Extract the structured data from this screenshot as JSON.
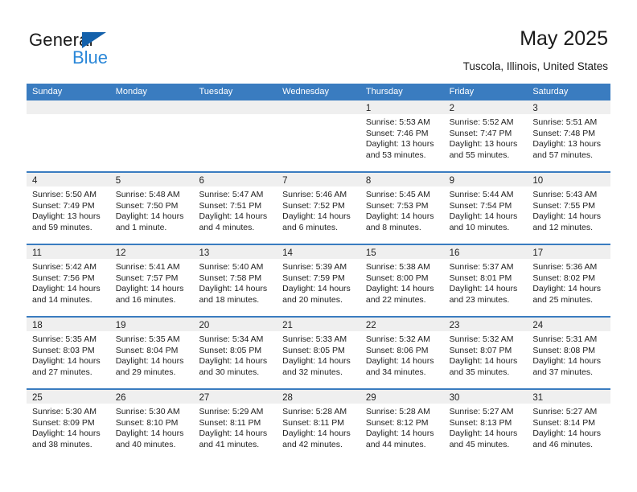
{
  "brand": {
    "name_primary": "General",
    "name_secondary": "Blue",
    "triangle_color": "#1461ab",
    "secondary_color": "#2a87d8"
  },
  "header": {
    "title": "May 2025",
    "subtitle": "Tuscola, Illinois, United States"
  },
  "theme": {
    "header_row_bg": "#3a7cc0",
    "header_row_text": "#ffffff",
    "daynum_band_bg": "#efefef",
    "cell_bg": "#ffffff",
    "text_color": "#222222"
  },
  "calendar": {
    "weekdays": [
      "Sunday",
      "Monday",
      "Tuesday",
      "Wednesday",
      "Thursday",
      "Friday",
      "Saturday"
    ],
    "weeks": [
      [
        {
          "day": "",
          "lines": []
        },
        {
          "day": "",
          "lines": []
        },
        {
          "day": "",
          "lines": []
        },
        {
          "day": "",
          "lines": []
        },
        {
          "day": "1",
          "lines": [
            "Sunrise: 5:53 AM",
            "Sunset: 7:46 PM",
            "Daylight: 13 hours",
            "and 53 minutes."
          ]
        },
        {
          "day": "2",
          "lines": [
            "Sunrise: 5:52 AM",
            "Sunset: 7:47 PM",
            "Daylight: 13 hours",
            "and 55 minutes."
          ]
        },
        {
          "day": "3",
          "lines": [
            "Sunrise: 5:51 AM",
            "Sunset: 7:48 PM",
            "Daylight: 13 hours",
            "and 57 minutes."
          ]
        }
      ],
      [
        {
          "day": "4",
          "lines": [
            "Sunrise: 5:50 AM",
            "Sunset: 7:49 PM",
            "Daylight: 13 hours",
            "and 59 minutes."
          ]
        },
        {
          "day": "5",
          "lines": [
            "Sunrise: 5:48 AM",
            "Sunset: 7:50 PM",
            "Daylight: 14 hours",
            "and 1 minute."
          ]
        },
        {
          "day": "6",
          "lines": [
            "Sunrise: 5:47 AM",
            "Sunset: 7:51 PM",
            "Daylight: 14 hours",
            "and 4 minutes."
          ]
        },
        {
          "day": "7",
          "lines": [
            "Sunrise: 5:46 AM",
            "Sunset: 7:52 PM",
            "Daylight: 14 hours",
            "and 6 minutes."
          ]
        },
        {
          "day": "8",
          "lines": [
            "Sunrise: 5:45 AM",
            "Sunset: 7:53 PM",
            "Daylight: 14 hours",
            "and 8 minutes."
          ]
        },
        {
          "day": "9",
          "lines": [
            "Sunrise: 5:44 AM",
            "Sunset: 7:54 PM",
            "Daylight: 14 hours",
            "and 10 minutes."
          ]
        },
        {
          "day": "10",
          "lines": [
            "Sunrise: 5:43 AM",
            "Sunset: 7:55 PM",
            "Daylight: 14 hours",
            "and 12 minutes."
          ]
        }
      ],
      [
        {
          "day": "11",
          "lines": [
            "Sunrise: 5:42 AM",
            "Sunset: 7:56 PM",
            "Daylight: 14 hours",
            "and 14 minutes."
          ]
        },
        {
          "day": "12",
          "lines": [
            "Sunrise: 5:41 AM",
            "Sunset: 7:57 PM",
            "Daylight: 14 hours",
            "and 16 minutes."
          ]
        },
        {
          "day": "13",
          "lines": [
            "Sunrise: 5:40 AM",
            "Sunset: 7:58 PM",
            "Daylight: 14 hours",
            "and 18 minutes."
          ]
        },
        {
          "day": "14",
          "lines": [
            "Sunrise: 5:39 AM",
            "Sunset: 7:59 PM",
            "Daylight: 14 hours",
            "and 20 minutes."
          ]
        },
        {
          "day": "15",
          "lines": [
            "Sunrise: 5:38 AM",
            "Sunset: 8:00 PM",
            "Daylight: 14 hours",
            "and 22 minutes."
          ]
        },
        {
          "day": "16",
          "lines": [
            "Sunrise: 5:37 AM",
            "Sunset: 8:01 PM",
            "Daylight: 14 hours",
            "and 23 minutes."
          ]
        },
        {
          "day": "17",
          "lines": [
            "Sunrise: 5:36 AM",
            "Sunset: 8:02 PM",
            "Daylight: 14 hours",
            "and 25 minutes."
          ]
        }
      ],
      [
        {
          "day": "18",
          "lines": [
            "Sunrise: 5:35 AM",
            "Sunset: 8:03 PM",
            "Daylight: 14 hours",
            "and 27 minutes."
          ]
        },
        {
          "day": "19",
          "lines": [
            "Sunrise: 5:35 AM",
            "Sunset: 8:04 PM",
            "Daylight: 14 hours",
            "and 29 minutes."
          ]
        },
        {
          "day": "20",
          "lines": [
            "Sunrise: 5:34 AM",
            "Sunset: 8:05 PM",
            "Daylight: 14 hours",
            "and 30 minutes."
          ]
        },
        {
          "day": "21",
          "lines": [
            "Sunrise: 5:33 AM",
            "Sunset: 8:05 PM",
            "Daylight: 14 hours",
            "and 32 minutes."
          ]
        },
        {
          "day": "22",
          "lines": [
            "Sunrise: 5:32 AM",
            "Sunset: 8:06 PM",
            "Daylight: 14 hours",
            "and 34 minutes."
          ]
        },
        {
          "day": "23",
          "lines": [
            "Sunrise: 5:32 AM",
            "Sunset: 8:07 PM",
            "Daylight: 14 hours",
            "and 35 minutes."
          ]
        },
        {
          "day": "24",
          "lines": [
            "Sunrise: 5:31 AM",
            "Sunset: 8:08 PM",
            "Daylight: 14 hours",
            "and 37 minutes."
          ]
        }
      ],
      [
        {
          "day": "25",
          "lines": [
            "Sunrise: 5:30 AM",
            "Sunset: 8:09 PM",
            "Daylight: 14 hours",
            "and 38 minutes."
          ]
        },
        {
          "day": "26",
          "lines": [
            "Sunrise: 5:30 AM",
            "Sunset: 8:10 PM",
            "Daylight: 14 hours",
            "and 40 minutes."
          ]
        },
        {
          "day": "27",
          "lines": [
            "Sunrise: 5:29 AM",
            "Sunset: 8:11 PM",
            "Daylight: 14 hours",
            "and 41 minutes."
          ]
        },
        {
          "day": "28",
          "lines": [
            "Sunrise: 5:28 AM",
            "Sunset: 8:11 PM",
            "Daylight: 14 hours",
            "and 42 minutes."
          ]
        },
        {
          "day": "29",
          "lines": [
            "Sunrise: 5:28 AM",
            "Sunset: 8:12 PM",
            "Daylight: 14 hours",
            "and 44 minutes."
          ]
        },
        {
          "day": "30",
          "lines": [
            "Sunrise: 5:27 AM",
            "Sunset: 8:13 PM",
            "Daylight: 14 hours",
            "and 45 minutes."
          ]
        },
        {
          "day": "31",
          "lines": [
            "Sunrise: 5:27 AM",
            "Sunset: 8:14 PM",
            "Daylight: 14 hours",
            "and 46 minutes."
          ]
        }
      ]
    ]
  }
}
